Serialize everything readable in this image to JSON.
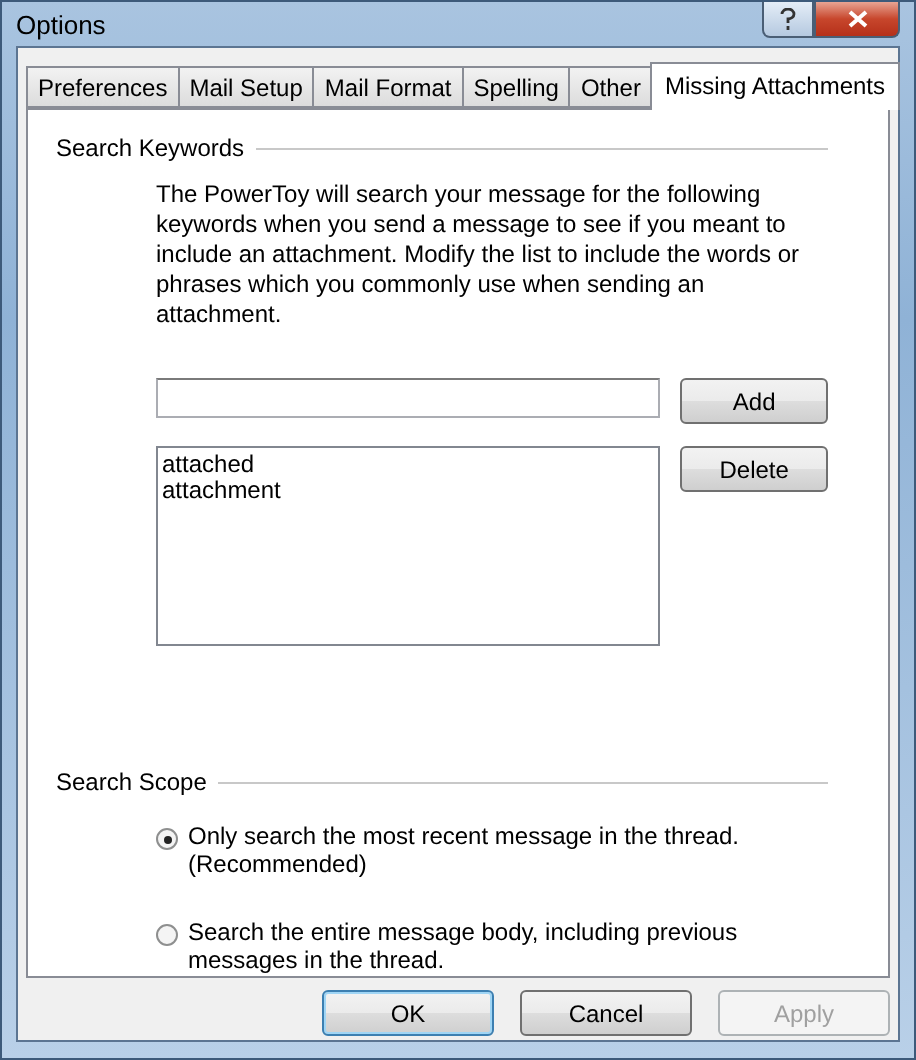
{
  "window": {
    "title": "Options"
  },
  "tabs": [
    {
      "label": "Preferences",
      "selected": false
    },
    {
      "label": "Mail Setup",
      "selected": false
    },
    {
      "label": "Mail Format",
      "selected": false
    },
    {
      "label": "Spelling",
      "selected": false
    },
    {
      "label": "Other",
      "selected": false
    },
    {
      "label": "Missing Attachments",
      "selected": true
    }
  ],
  "keywords": {
    "heading": "Search Keywords",
    "description": "The PowerToy will search your message for the following keywords when you send a message to see if you meant to include an attachment. Modify the list to include the words or phrases which you commonly use when sending an attachment.",
    "add_button": "Add",
    "delete_button": "Delete",
    "items": [
      "attached",
      "attachment"
    ]
  },
  "scope": {
    "heading": "Search Scope",
    "options": [
      {
        "label": "Only search the most recent message in the thread. (Recommended)",
        "selected": true
      },
      {
        "label": "Search the entire message body, including previous messages in the thread.",
        "selected": false
      }
    ]
  },
  "buttons": [
    {
      "label": "OK",
      "disabled": false,
      "default": true
    },
    {
      "label": "Cancel",
      "disabled": false,
      "default": false
    },
    {
      "label": "Apply",
      "disabled": true,
      "default": false
    }
  ]
}
